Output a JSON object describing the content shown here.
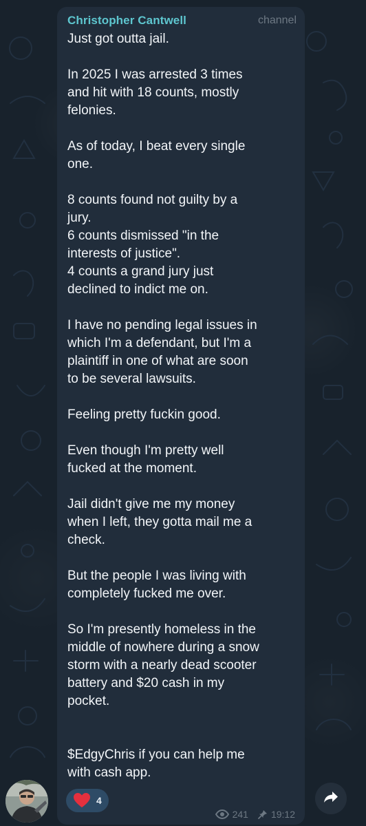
{
  "post": {
    "author": "Christopher Cantwell",
    "badge": "channel",
    "paragraphs": [
      "Just got outta jail.",
      "In 2025 I was arrested 3 times\nand hit with 18 counts, mostly\nfelonies.",
      "As of today, I beat every single\none.",
      "8 counts found not guilty by a\njury.\n6 counts dismissed \"in the\ninterests of justice\".\n4 counts a grand jury just\ndeclined to indict me on.",
      "I have no pending legal issues in\nwhich I'm a defendant, but I'm a\nplaintiff in one of what are soon\nto be several lawsuits.",
      "Feeling pretty fuckin good.",
      "Even though I'm pretty well\nfucked at the moment.",
      "Jail didn't give me my money\nwhen I left, they gotta mail me a\ncheck.",
      "But the people I was living with\ncompletely fucked me over.",
      "So I'm presently homeless in the\nmiddle of nowhere during a snow\nstorm with a nearly dead scooter\nbattery and $20 cash in my\npocket.",
      "$EdgyChris if you can help me\nwith cash app."
    ],
    "reaction": {
      "icon": "heart-icon",
      "count": "4"
    },
    "views": "241",
    "time": "19:12"
  },
  "colors": {
    "background": "#18222c",
    "bubble": "#212d3b",
    "author": "#5ec6cf",
    "text": "#f2f5f8",
    "muted": "#6d7883",
    "reaction_bg": "#2e4b66",
    "heart": "#e5303e"
  },
  "icons": {
    "views": "eye-icon",
    "pinned": "pin-icon",
    "share": "share-arrow-icon"
  }
}
